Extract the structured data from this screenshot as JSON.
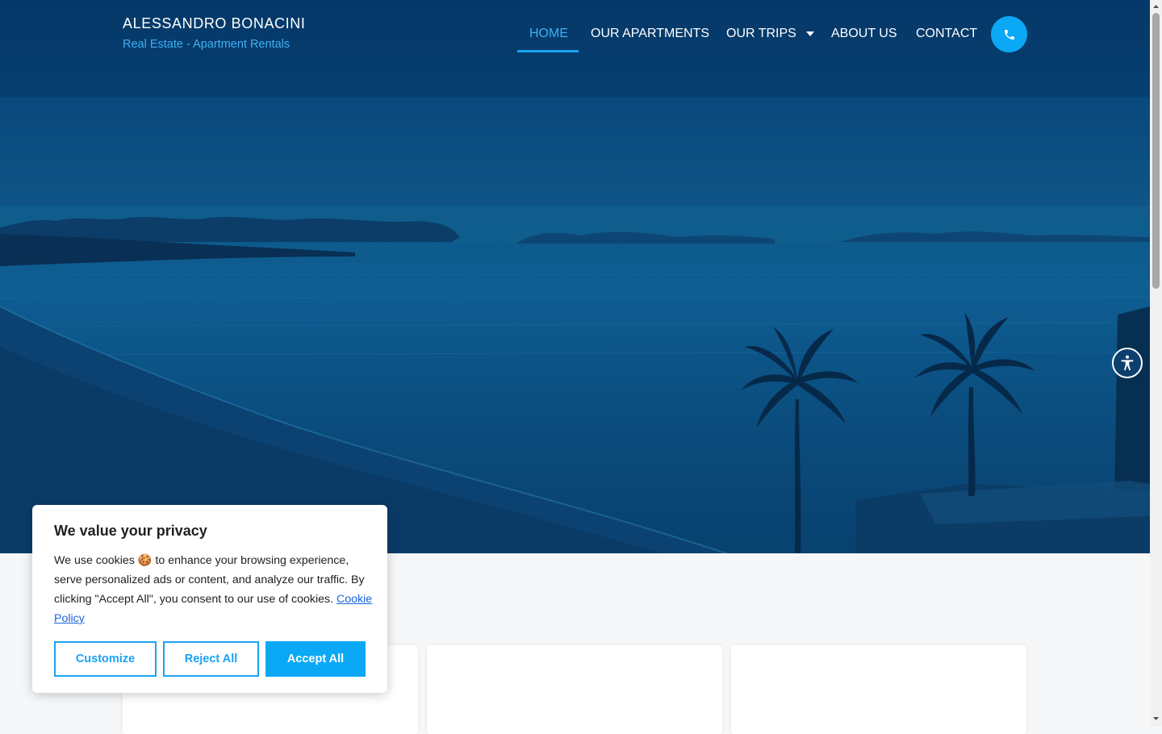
{
  "header": {
    "brand_name": "ALESSANDRO BONACINI",
    "brand_tagline": "Real Estate - Apartment Rentals"
  },
  "nav": {
    "items": [
      {
        "label": "HOME",
        "active": true
      },
      {
        "label": "OUR APARTMENTS",
        "active": false
      },
      {
        "label": "OUR TRIPS",
        "active": false,
        "has_dropdown": true
      },
      {
        "label": "ABOUT US",
        "active": false
      },
      {
        "label": "CONTACT",
        "active": false
      }
    ],
    "phone_icon": "phone-icon"
  },
  "hero": {
    "image_description": "seaside-sunset-with-palm-trees",
    "overlay_color": "#0a4a7e"
  },
  "accessibility": {
    "icon": "accessibility-icon"
  },
  "cookie_banner": {
    "title": "We value your privacy",
    "text_before_emoji": "We use cookies ",
    "emoji": "🍪",
    "text_after_emoji": " to enhance your browsing experience, serve personalized ads or content, and analyze our traffic. By clicking \"Accept All\", you consent to our use of cookies.",
    "policy_link": "Cookie Policy",
    "buttons": {
      "customize": "Customize",
      "reject": "Reject All",
      "accept": "Accept All"
    }
  },
  "colors": {
    "accent": "#0aa8f5",
    "nav_active": "#3fb0f4",
    "link": "#1863dc"
  }
}
